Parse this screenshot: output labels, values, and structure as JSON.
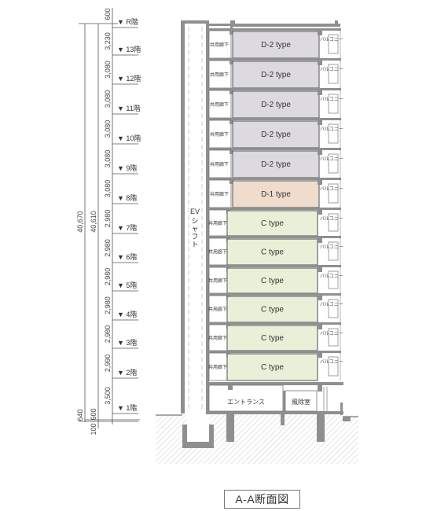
{
  "title": "A-A断面図",
  "dimensions": {
    "overall_total": "40,670",
    "structure_total": "40,610",
    "base_outer": "640",
    "base_inner_bottom": "100",
    "base_inner_top": "600",
    "top_parapet": "600"
  },
  "levels": [
    {
      "label": "R階",
      "height_below": "3,230"
    },
    {
      "label": "13階",
      "height_below": "3,080"
    },
    {
      "label": "12階",
      "height_below": "3,080"
    },
    {
      "label": "11階",
      "height_below": "3,080"
    },
    {
      "label": "10階",
      "height_below": "3,080"
    },
    {
      "label": "9階",
      "height_below": "3,080"
    },
    {
      "label": "8階",
      "height_below": "2,980"
    },
    {
      "label": "7階",
      "height_below": "2,980"
    },
    {
      "label": "6階",
      "height_below": "2,980"
    },
    {
      "label": "5階",
      "height_below": "2,980"
    },
    {
      "label": "4階",
      "height_below": "2,980"
    },
    {
      "label": "3階",
      "height_below": "2,990"
    },
    {
      "label": "2階",
      "height_below": "3,500"
    },
    {
      "label": "1階",
      "height_below": ""
    }
  ],
  "level_marker": "▼",
  "floors": [
    {
      "floor": "13階",
      "unit": "D-2 type",
      "corridor": "共用廊下",
      "balcony": "バルコニー",
      "kind": "D2"
    },
    {
      "floor": "12階",
      "unit": "D-2 type",
      "corridor": "共用廊下",
      "balcony": "バルコニー",
      "kind": "D2"
    },
    {
      "floor": "11階",
      "unit": "D-2 type",
      "corridor": "共用廊下",
      "balcony": "バルコニー",
      "kind": "D2"
    },
    {
      "floor": "10階",
      "unit": "D-2 type",
      "corridor": "共用廊下",
      "balcony": "バルコニー",
      "kind": "D2"
    },
    {
      "floor": "9階",
      "unit": "D-2 type",
      "corridor": "共用廊下",
      "balcony": "バルコニー",
      "kind": "D2"
    },
    {
      "floor": "8階",
      "unit": "D-1 type",
      "corridor": "共用廊下",
      "balcony": "バルコニー",
      "kind": "D1"
    },
    {
      "floor": "7階",
      "unit": "C type",
      "corridor": "共用廊下",
      "balcony": "バルコニー",
      "kind": "C"
    },
    {
      "floor": "6階",
      "unit": "C type",
      "corridor": "共用廊下",
      "balcony": "バルコニー",
      "kind": "C"
    },
    {
      "floor": "5階",
      "unit": "C type",
      "corridor": "共用廊下",
      "balcony": "バルコニー",
      "kind": "C"
    },
    {
      "floor": "4階",
      "unit": "C type",
      "corridor": "共用廊下",
      "balcony": "バルコニー",
      "kind": "C"
    },
    {
      "floor": "3階",
      "unit": "C type",
      "corridor": "共用廊下",
      "balcony": "バルコニー",
      "kind": "C"
    },
    {
      "floor": "2階",
      "unit": "C type",
      "corridor": "共用廊下",
      "balcony": "バルコニー",
      "kind": "C"
    }
  ],
  "ground_floor": {
    "entrance": "エントランス",
    "windbreak": "風除室"
  },
  "ev_shaft": {
    "line1": "EV",
    "line2": "シャフト"
  },
  "colors": {
    "D2": "#dcdae0",
    "D1": "#efdccd",
    "C": "#e8f0d8",
    "structure": "#8f8f8f",
    "line": "#555555"
  }
}
